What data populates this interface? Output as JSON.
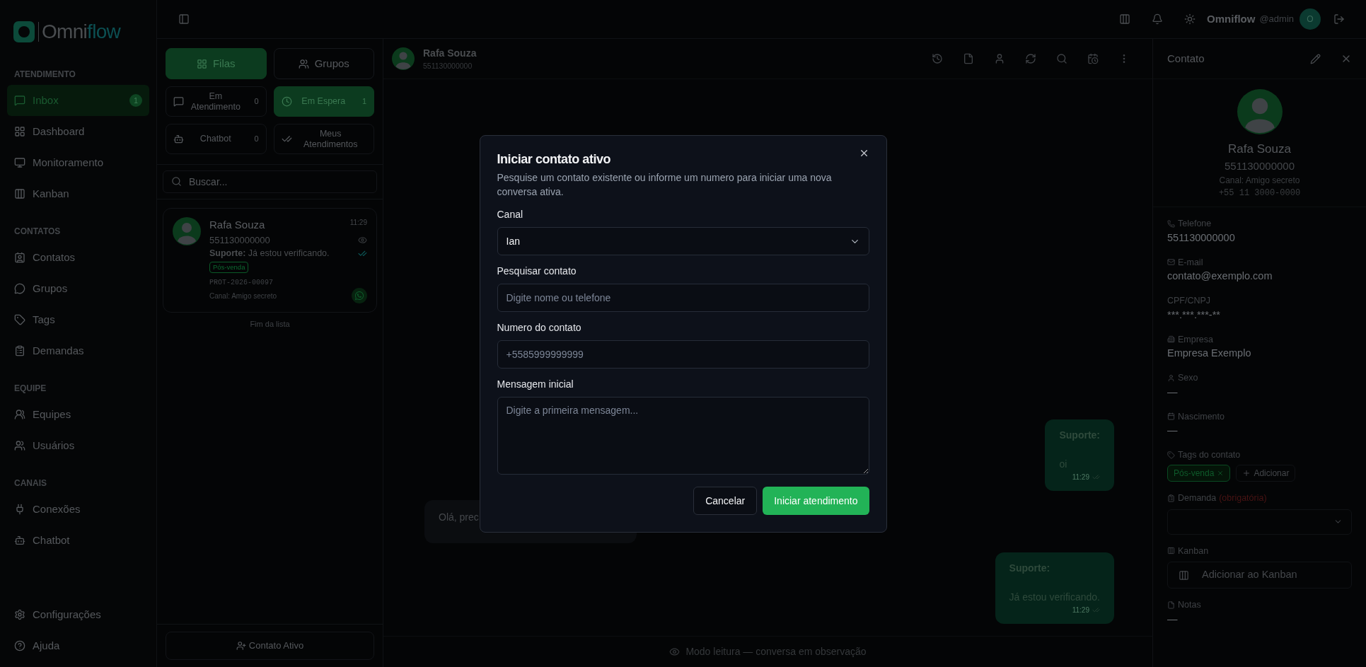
{
  "sidebar": {
    "logo": [
      "Omni",
      "flow"
    ],
    "sections": [
      {
        "title": "ATENDIMENTO",
        "items": [
          {
            "label": "Inbox",
            "selected": true,
            "badge": "1"
          },
          {
            "label": "Dashboard",
            "selected": false
          },
          {
            "label": "Monitoramento",
            "selected": false
          },
          {
            "label": "Kanban",
            "selected": false
          }
        ]
      },
      {
        "title": "CONTATOS",
        "items": [
          {
            "label": "Contatos",
            "selected": false
          },
          {
            "label": "Grupos",
            "selected": false
          },
          {
            "label": "Tags",
            "selected": false
          },
          {
            "label": "Demandas",
            "selected": false
          }
        ]
      },
      {
        "title": "EQUIPE",
        "items": [
          {
            "label": "Equipes",
            "selected": false
          },
          {
            "label": "Usuários",
            "selected": false
          }
        ]
      },
      {
        "title": "CANAIS",
        "items": [
          {
            "label": "Conexões",
            "selected": false
          },
          {
            "label": "Chatbot",
            "selected": false
          }
        ]
      }
    ],
    "footer_items": [
      "Configurações",
      "Ajuda"
    ]
  },
  "topbar": {
    "brand": "Omniflow",
    "user": "@admin",
    "avatar_initial": "O"
  },
  "queue_panel": {
    "tabs": [
      {
        "label": "Filas",
        "selected": true
      },
      {
        "label": "Grupos",
        "selected": false
      }
    ],
    "filters": [
      {
        "label": "Em Atendimento",
        "count": "0",
        "selected": false
      },
      {
        "label": "Em Espera",
        "count": "1",
        "selected": true
      },
      {
        "label": "Chatbot",
        "count": "0",
        "selected": false
      },
      {
        "label": "Meus Atendimentos",
        "selected": false
      }
    ],
    "search": {
      "placeholder": "Buscar..."
    },
    "conversations": [
      {
        "name": "Rafa Souza",
        "time": "11:29",
        "number": "551130000000",
        "preview": "**Suporte:** Já estou verificando.",
        "tag": "Pós-venda",
        "protocol": "PROT-2026-00097",
        "channel": "Canal: Amigo secreto"
      }
    ],
    "end_label": "Fim da lista",
    "action": "Contato Ativo"
  },
  "chat": {
    "contact_name": "Rafa Souza",
    "contact_number": "551130000000",
    "messages": [
      {
        "kind": "outgoing",
        "sender": "Suporte:",
        "text": "oi",
        "time": "11:29"
      },
      {
        "kind": "incoming",
        "text": "Olá, prec"
      },
      {
        "kind": "outgoing",
        "sender": "Suporte:",
        "text": "Já estou verificando.",
        "time": "11:29"
      }
    ],
    "footer": "Modo leitura — conversa em observação"
  },
  "contact_panel": {
    "title": "Contato",
    "name": "Rafa Souza",
    "number": "551130000000",
    "channel": "Canal: Amigo secreto",
    "phone": "+55 11 3000-0000",
    "fields": [
      {
        "kind": "text",
        "label": "Telefone",
        "value": "551130000000"
      },
      {
        "kind": "text",
        "label": "E-mail",
        "value": "contato@exemplo.com"
      },
      {
        "kind": "text",
        "label": "CPF/CNPJ",
        "value": "***.***.***-**"
      },
      {
        "kind": "text",
        "label": "Empresa",
        "value": "Empresa Exemplo"
      },
      {
        "kind": "text",
        "label": "Sexo",
        "value": "—"
      },
      {
        "kind": "text",
        "label": "Nascimento",
        "value": "—"
      },
      {
        "kind": "tags",
        "label": "Tags do contato",
        "tags": [
          "Pós-venda"
        ],
        "add": "Adicionar"
      },
      {
        "kind": "select",
        "label": "Demanda",
        "note": "(obrigatória)"
      },
      {
        "kind": "button",
        "label": "Kanban",
        "button": "Adicionar ao Kanban"
      },
      {
        "kind": "text",
        "label": "Notas",
        "value": "—"
      }
    ]
  },
  "modal": {
    "title": "Iniciar contato ativo",
    "description": "Pesquise um contato existente ou informe um numero para iniciar uma nova conversa ativa.",
    "fields": [
      {
        "kind": "select",
        "label": "Canal",
        "value": "Ian"
      },
      {
        "kind": "input",
        "label": "Pesquisar contato",
        "placeholder": "Digite nome ou telefone"
      },
      {
        "kind": "input",
        "label": "Numero do contato",
        "placeholder": "+5585999999999"
      },
      {
        "kind": "textarea",
        "label": "Mensagem inicial",
        "placeholder": "Digite a primeira mensagem..."
      }
    ],
    "cancel": "Cancelar",
    "submit": "Iniciar atendimento"
  }
}
